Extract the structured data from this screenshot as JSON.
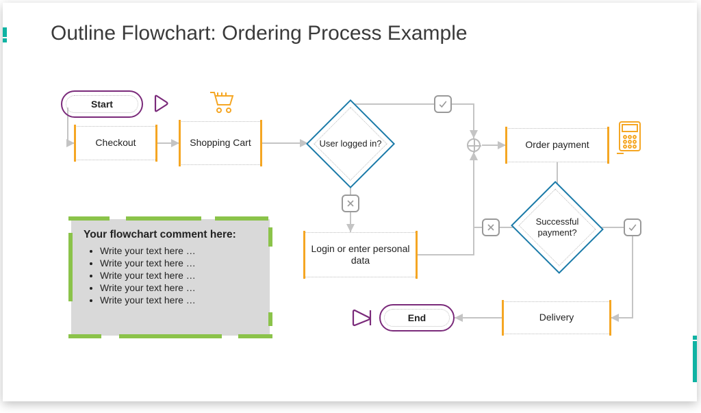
{
  "title": "Outline Flowchart: Ordering Process Example",
  "nodes": {
    "start": "Start",
    "checkout": "Checkout",
    "cart": "Shopping Cart",
    "loggedin": "User logged in?",
    "login": "Login or enter personal data",
    "orderpay": "Order payment",
    "paysucc": "Successful payment?",
    "delivery": "Delivery",
    "end": "End"
  },
  "comment": {
    "heading": "Your flowchart comment here:",
    "items": [
      "Write your text here …",
      "Write your text here …",
      "Write your text here …",
      "Write your text here …",
      "Write your text here …"
    ]
  },
  "icons": {
    "play": "play-icon",
    "cart": "cart-icon",
    "check": "check-icon",
    "cross": "cross-icon",
    "stop": "stop-icon",
    "terminal": "terminal-icon"
  },
  "colors": {
    "accent": "#0fb3a3",
    "orange": "#f5a623",
    "purple": "#7a2a7a",
    "blue": "#1a7aa8",
    "green": "#8bc34a"
  },
  "chart_data": {
    "type": "flowchart",
    "title": "Ordering Process Example",
    "nodes": [
      {
        "id": "start",
        "type": "terminator",
        "label": "Start"
      },
      {
        "id": "checkout",
        "type": "process",
        "label": "Checkout"
      },
      {
        "id": "cart",
        "type": "process",
        "label": "Shopping Cart"
      },
      {
        "id": "loggedin",
        "type": "decision",
        "label": "User logged in?"
      },
      {
        "id": "login",
        "type": "process",
        "label": "Login or enter personal data"
      },
      {
        "id": "junction",
        "type": "connector",
        "label": ""
      },
      {
        "id": "orderpay",
        "type": "process",
        "label": "Order payment"
      },
      {
        "id": "paysucc",
        "type": "decision",
        "label": "Successful payment?"
      },
      {
        "id": "delivery",
        "type": "process",
        "label": "Delivery"
      },
      {
        "id": "end",
        "type": "terminator",
        "label": "End"
      }
    ],
    "edges": [
      {
        "from": "start",
        "to": "checkout"
      },
      {
        "from": "checkout",
        "to": "cart"
      },
      {
        "from": "cart",
        "to": "loggedin"
      },
      {
        "from": "loggedin",
        "to": "junction",
        "label": "yes"
      },
      {
        "from": "loggedin",
        "to": "login",
        "label": "no"
      },
      {
        "from": "login",
        "to": "junction"
      },
      {
        "from": "junction",
        "to": "orderpay"
      },
      {
        "from": "orderpay",
        "to": "paysucc"
      },
      {
        "from": "paysucc",
        "to": "delivery",
        "label": "yes"
      },
      {
        "from": "paysucc",
        "to": "orderpay",
        "label": "no"
      },
      {
        "from": "delivery",
        "to": "end"
      }
    ]
  }
}
